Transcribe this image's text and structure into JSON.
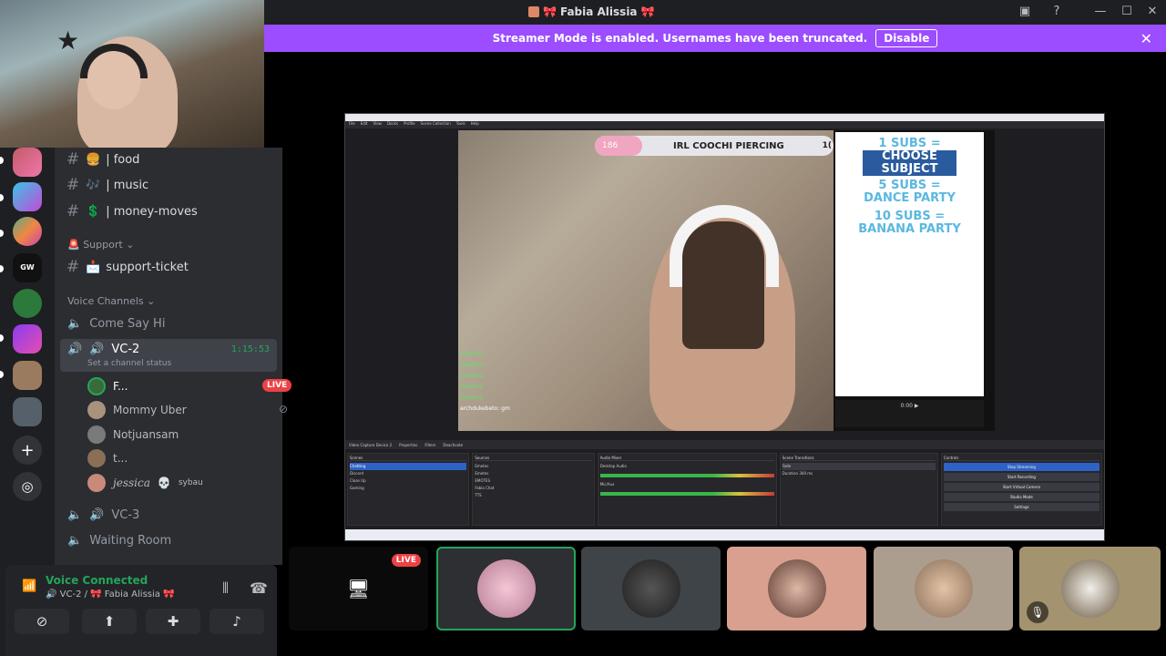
{
  "window": {
    "title": "Fabia Alissia",
    "title_ribbon_left": "🎀",
    "title_ribbon_right": "🎀"
  },
  "banner": {
    "text": "Streamer Mode is enabled. Usernames have been truncated.",
    "disable_label": "Disable"
  },
  "channels": [
    {
      "emoji": "🍔",
      "name": "| food"
    },
    {
      "emoji": "🎶",
      "name": "| music"
    },
    {
      "emoji": "💲",
      "name": "| money-moves"
    }
  ],
  "support": {
    "category": "Support",
    "channel_emoji": "📩",
    "channel": "support-ticket"
  },
  "voice": {
    "category": "Voice Channels",
    "channels": {
      "come_say_hi": "Come Say Hi",
      "vc2": "VC-2",
      "vc2_timer": "1:15:53",
      "vc2_status_placeholder": "Set a channel status",
      "vc3": "VC-3",
      "waiting": "Waiting Room"
    },
    "users": [
      {
        "name": "F...",
        "live": "LIVE"
      },
      {
        "name": "Mommy Uber"
      },
      {
        "name": "Notjuansam"
      },
      {
        "name": "t..."
      },
      {
        "name": "jessica",
        "tag": "sybau"
      }
    ]
  },
  "panel": {
    "status": "Voice Connected",
    "location": "VC-2 / 🎀 Fabia Alissia 🎀"
  },
  "stream": {
    "goal_count": "186",
    "goal_text": "IRL COOCHI PIERCING",
    "goal_right": "1(",
    "subs": [
      "1 SUBS =",
      "CHOOSE SUBJECT",
      "5 SUBS =",
      "DANCE PARTY",
      "10 SUBS =",
      "BANANA PARTY"
    ],
    "chat": [
      "KadotUL:",
      "KadotUL:",
      "KadotUL:",
      "KadotUL:",
      "KadotUL:",
      "archdukebeto: gm"
    ],
    "time": "0:00"
  },
  "obs": {
    "menu": [
      "File",
      "Edit",
      "View",
      "Docks",
      "Profile",
      "Scene Collection",
      "Tools",
      "Help"
    ],
    "scenes_header": "Scenes",
    "scenes": [
      "Chatting",
      "Discord",
      "Close Up",
      "Gaming"
    ],
    "sources_header": "Sources",
    "sources": [
      "Emotes",
      "Emotes",
      "EMOTES",
      "Fabia Chat",
      "TTS"
    ],
    "mixer_header": "Audio Mixer",
    "mixer": [
      "Desktop Audio",
      "Mic/Aux"
    ],
    "transitions_header": "Scene Transitions",
    "transition": "Fade",
    "duration_label": "Duration",
    "duration": "300 ms",
    "controls_header": "Controls",
    "controls": [
      "Stop Streaming",
      "Start Recording",
      "Start Virtual Camera",
      "Studio Mode",
      "Settings"
    ],
    "props": [
      "Video Capture Device 2",
      "Properties",
      "Filters",
      "Deactivate"
    ]
  },
  "tiles": {
    "live_label": "LIVE"
  },
  "colors": {
    "accent": "#9b4dff",
    "green": "#23a55a",
    "live": "#ed4245"
  }
}
